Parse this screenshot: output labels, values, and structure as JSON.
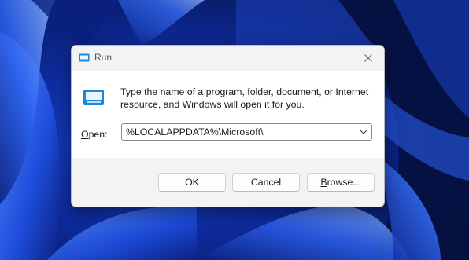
{
  "dialog": {
    "title": "Run",
    "description": "Type the name of a program, folder, document, or Internet resource, and Windows will open it for you.",
    "open_label_accel": "O",
    "open_label_rest": "pen:",
    "open_value": "%LOCALAPPDATA%\\Microsoft\\",
    "buttons": {
      "ok": "OK",
      "cancel": "Cancel",
      "browse_accel": "B",
      "browse_rest": "rowse..."
    }
  },
  "icons": {
    "title": "run-icon",
    "body": "run-icon",
    "close": "close-icon",
    "dropdown": "chevron-down-icon"
  },
  "colors": {
    "desktop_dark": "#04113d",
    "desktop_blue": "#1f4fe0",
    "desktop_light": "#4f86ff",
    "dialog_bg": "#f3f3f3",
    "content_bg": "#ffffff",
    "icon_accent": "#1e88d8"
  }
}
